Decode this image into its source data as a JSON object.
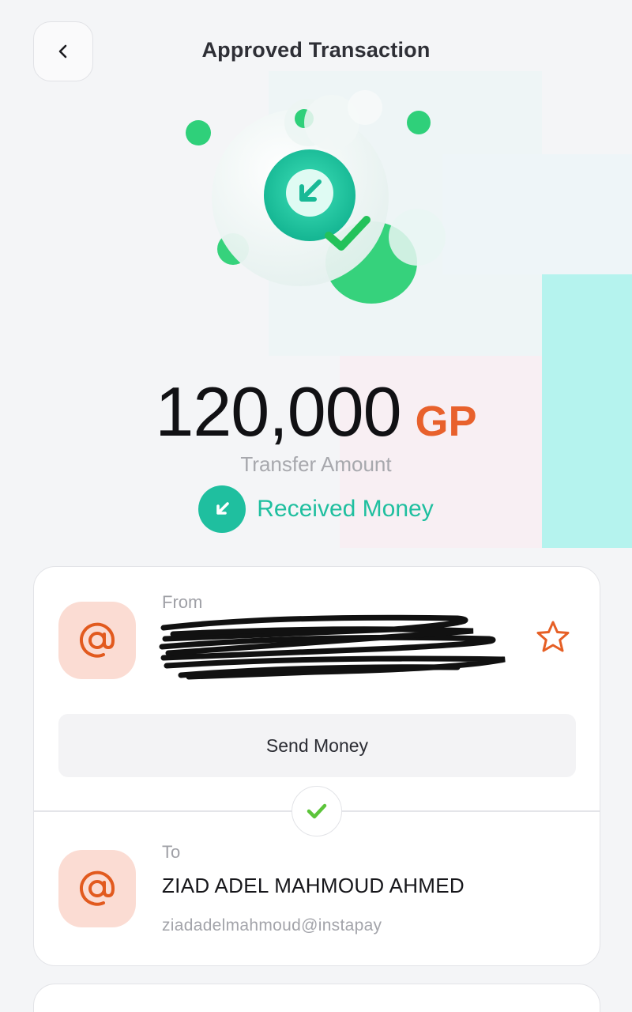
{
  "header": {
    "title": "Approved Transaction",
    "back_icon": "chevron-left-icon"
  },
  "amount": {
    "value": "120,000",
    "currency": "GP",
    "label": "Transfer Amount"
  },
  "status": {
    "text": "Received Money",
    "icon": "arrow-down-left-icon",
    "color": "#1fbf9f"
  },
  "from": {
    "label": "From",
    "name_redacted": true,
    "icon": "at-sign-icon",
    "favorite_icon": "star-icon"
  },
  "send_money_label": "Send Money",
  "to": {
    "label": "To",
    "name": "ZIAD ADEL MAHMOUD AHMED",
    "handle": "ziadadelmahmoud@instapay",
    "icon": "at-sign-icon"
  },
  "colors": {
    "accent_green": "#1fbf9f",
    "currency_orange": "#e8612c",
    "avatar_bg": "#fbdcd3"
  }
}
